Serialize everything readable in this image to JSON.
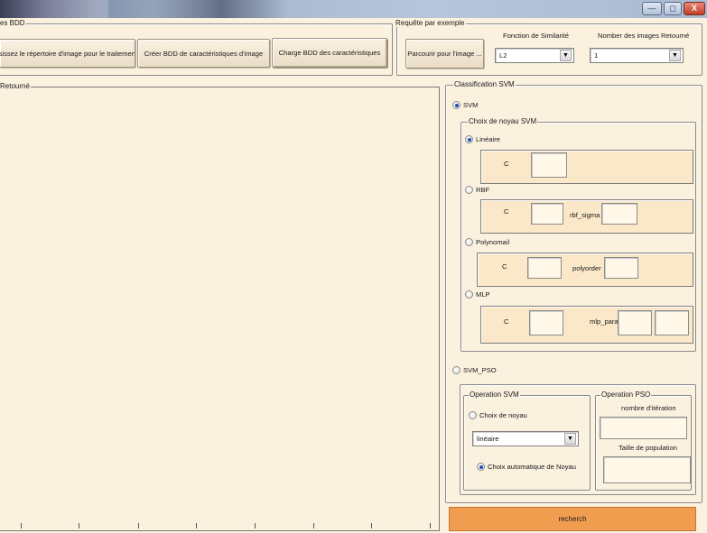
{
  "window": {
    "minimize_icon": "minimize-icon",
    "maximize_icon": "maximize-icon",
    "close_icon": "close-icon",
    "minimize_glyph": "—",
    "maximize_glyph": "◻",
    "close_glyph": "X"
  },
  "bdd_group": {
    "label": "es BDD",
    "choose_dir_button": "isissez le répertoire d'image pour le traitement",
    "create_bdd_button": "Créer BDD de caractéristiques d'image",
    "load_bdd_button": "Charge BDD des  caractéristiques"
  },
  "query_group": {
    "label": "Requête par exemple",
    "browse_button": "Parcourir pour  l'image ...",
    "similarity_label": "Fonction de Similarité",
    "similarity_value": "L2",
    "returned_label": "Nomber des images Retourné",
    "returned_value": "1"
  },
  "results_group": {
    "label": "Retourné"
  },
  "svm_group": {
    "label": "Classification  SVM",
    "svm_radio": "SVM",
    "svm_radio_selected": true,
    "kernel_group_label": "Choix de noyau SVM",
    "linear": {
      "label": "Linéaire",
      "selected": true,
      "c_label": "C"
    },
    "rbf": {
      "label": "RBF",
      "selected": false,
      "c_label": "C",
      "param_label": "rbf_sigma"
    },
    "poly": {
      "label": "Polynomail",
      "selected": false,
      "c_label": "C",
      "param_label": "polyorder"
    },
    "mlp": {
      "label": "MLP",
      "selected": false,
      "c_label": "C",
      "param_label": "mlp_params"
    },
    "svm_pso_radio": "SVM_PSO",
    "svm_pso_selected": false,
    "operation_svm": {
      "label": "Operation SVM",
      "choose_kernel_radio": "Choix de noyau",
      "choose_kernel_selected": false,
      "kernel_dropdown_value": "linéaire",
      "auto_kernel_radio": "Choix  automatique de Noyau",
      "auto_kernel_selected": true
    },
    "operation_pso": {
      "label": "Operation PSO",
      "iterations_label": "nombre d'itération",
      "population_label": "Taille de population"
    }
  },
  "search_button": "recherch",
  "dropdown_arrow_glyph": "▼",
  "colors": {
    "background": "#fbf1df",
    "panel": "#fbe8c8",
    "search_button": "#f19d4f",
    "radio_selected": "#1f4fb5"
  }
}
